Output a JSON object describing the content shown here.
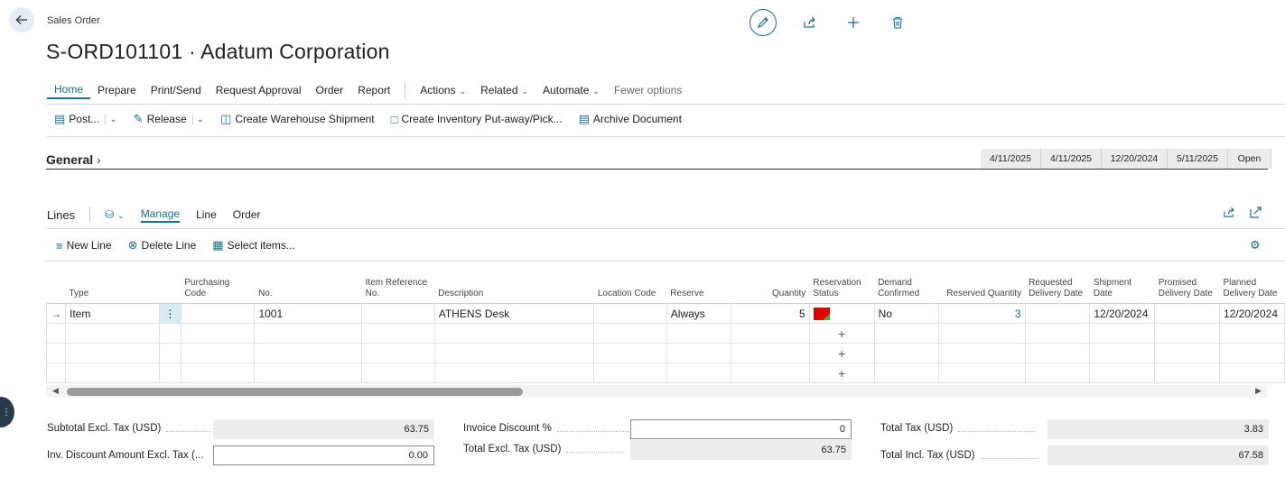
{
  "header": {
    "page_type": "Sales Order",
    "title": "S-ORD101101 · Adatum Corporation",
    "icons": [
      "back-arrow-icon",
      "edit-pencil-icon",
      "share-icon",
      "add-plus-icon",
      "delete-trash-icon"
    ]
  },
  "menu": {
    "items": [
      "Home",
      "Prepare",
      "Print/Send",
      "Request Approval",
      "Order",
      "Report"
    ],
    "dropdowns": [
      "Actions",
      "Related",
      "Automate"
    ],
    "fewer_options": "Fewer options",
    "active": "Home"
  },
  "actions": {
    "post": "Post...",
    "release": "Release",
    "create_shipment": "Create Warehouse Shipment",
    "create_putaway": "Create Inventory Put-away/Pick...",
    "archive": "Archive Document"
  },
  "general": {
    "title": "General",
    "summary": [
      "4/11/2025",
      "4/11/2025",
      "12/20/2024",
      "5/11/2025",
      "Open"
    ]
  },
  "lines": {
    "title": "Lines",
    "tabs": [
      "Manage",
      "Line",
      "Order"
    ],
    "active_tab": "Manage",
    "actions": {
      "new_line": "New Line",
      "delete_line": "Delete Line",
      "select_items": "Select items..."
    },
    "columns": [
      "Type",
      "Purchasing Code",
      "No.",
      "Item Reference No.",
      "Description",
      "Location Code",
      "Reserve",
      "Quantity",
      "Reservation Status",
      "Demand Confirmed",
      "Reserved Quantity",
      "Requested Delivery Date",
      "Shipment Date",
      "Promised Delivery Date",
      "Planned Delivery Date"
    ],
    "rows": [
      {
        "type": "Item",
        "purchasing_code": "",
        "no": "1001",
        "item_ref": "",
        "description": "ATHENS Desk",
        "location": "",
        "reserve": "Always",
        "quantity": "5",
        "demand_confirmed": "No",
        "reserved_qty": "3",
        "requested_date": "",
        "shipment_date": "12/20/2024",
        "promised_date": "",
        "planned_date": "12/20/2024"
      }
    ]
  },
  "totals": {
    "subtotal_label": "Subtotal Excl. Tax (USD)",
    "subtotal": "63.75",
    "inv_disc_amount_label": "Inv. Discount Amount Excl. Tax (...",
    "inv_disc_amount": "0.00",
    "invoice_discount_pct_label": "Invoice Discount %",
    "invoice_discount_pct": "0",
    "total_excl_label": "Total Excl. Tax (USD)",
    "total_excl": "63.75",
    "total_tax_label": "Total Tax (USD)",
    "total_tax": "3.83",
    "total_incl_label": "Total Incl. Tax (USD)",
    "total_incl": "67.58"
  },
  "colors": {
    "accent": "#1c6e8c",
    "status_red": "#e00000",
    "status_green": "#2bbd2b"
  }
}
